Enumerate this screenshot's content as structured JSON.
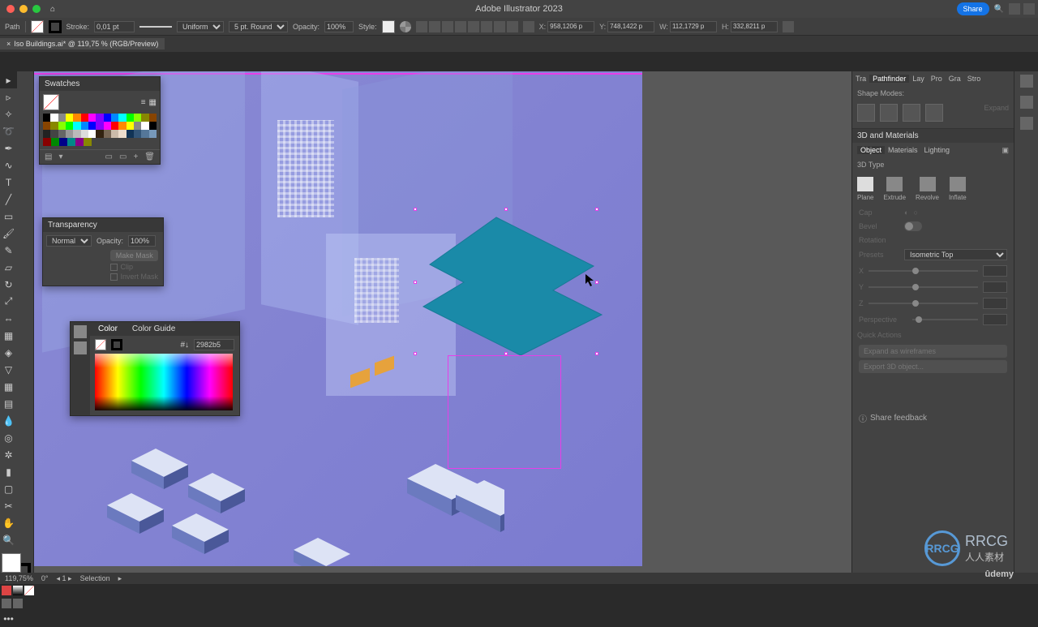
{
  "app_title": "Adobe Illustrator 2023",
  "share": "Share",
  "path_label": "Path",
  "doc_tab": "Iso Buildings.ai* @ 119,75 % (RGB/Preview)",
  "stroke": {
    "label": "Stroke:",
    "value": "0,01 pt"
  },
  "uniform": "Uniform",
  "brush": "5 pt. Round",
  "opacity": {
    "label": "Opacity:",
    "value": "100%"
  },
  "style_label": "Style:",
  "coords": {
    "x": "958,1206 p",
    "y": "748,1422 p",
    "w": "112,1729 p",
    "h": "332,8211 p"
  },
  "panels": {
    "swatches": "Swatches",
    "transparency": "Transparency",
    "color": "Color",
    "color_guide": "Color Guide",
    "pathfinder": "Pathfinder",
    "threeD": "3D and Materials",
    "tra": "Tra",
    "lay": "Lay",
    "pro": "Pro",
    "gra": "Gra",
    "str": "Stro"
  },
  "shape_modes": "Shape Modes:",
  "expand": "Expand",
  "transparency": {
    "mode": "Normal",
    "opacity_label": "Opacity:",
    "opacity_value": "100%",
    "make_mask": "Make Mask",
    "clip": "Clip",
    "invert": "Invert Mask"
  },
  "color_panel": {
    "mode": "#↓",
    "hex": "2982b5"
  },
  "materials_tabs": {
    "object": "Object",
    "materials": "Materials",
    "lighting": "Lighting"
  },
  "type3d": {
    "label": "3D Type",
    "plane": "Plane",
    "extrude": "Extrude",
    "revolve": "Revolve",
    "inflate": "Inflate"
  },
  "cap": "Cap",
  "bevel": "Bevel",
  "rotation": "Rotation",
  "presets": "Presets",
  "preset_sel": "Isometric Top",
  "axes": {
    "x": "X",
    "y": "Y",
    "z": "Z"
  },
  "perspective": "Perspective",
  "quick_actions": "Quick Actions",
  "qa1": "Expand as wireframes",
  "qa2": "Export 3D object...",
  "feedback": "Share feedback",
  "status": {
    "zoom": "119,75%",
    "rot": "0°",
    "art": "1",
    "tool": "Selection"
  },
  "swatch_colors_a": [
    "#000",
    "#fff",
    "#888",
    "#ff0",
    "#f80",
    "#f00",
    "#f0f",
    "#80f",
    "#00f",
    "#08f",
    "#0ff",
    "#0f0",
    "#8f0",
    "#880",
    "#840"
  ],
  "swatch_colors_b": [
    "#222",
    "#444",
    "#666",
    "#999",
    "#bbb",
    "#ddd",
    "#fff",
    "#321",
    "#765",
    "#cba",
    "#edc",
    "#135",
    "#357",
    "#579",
    "#79b"
  ],
  "swatch_colors_c": [
    "#800",
    "#080",
    "#008",
    "#088",
    "#808",
    "#880"
  ],
  "watermark_text": "RRCG",
  "watermark_sub": "人人素材",
  "udemy": "ûdemy"
}
